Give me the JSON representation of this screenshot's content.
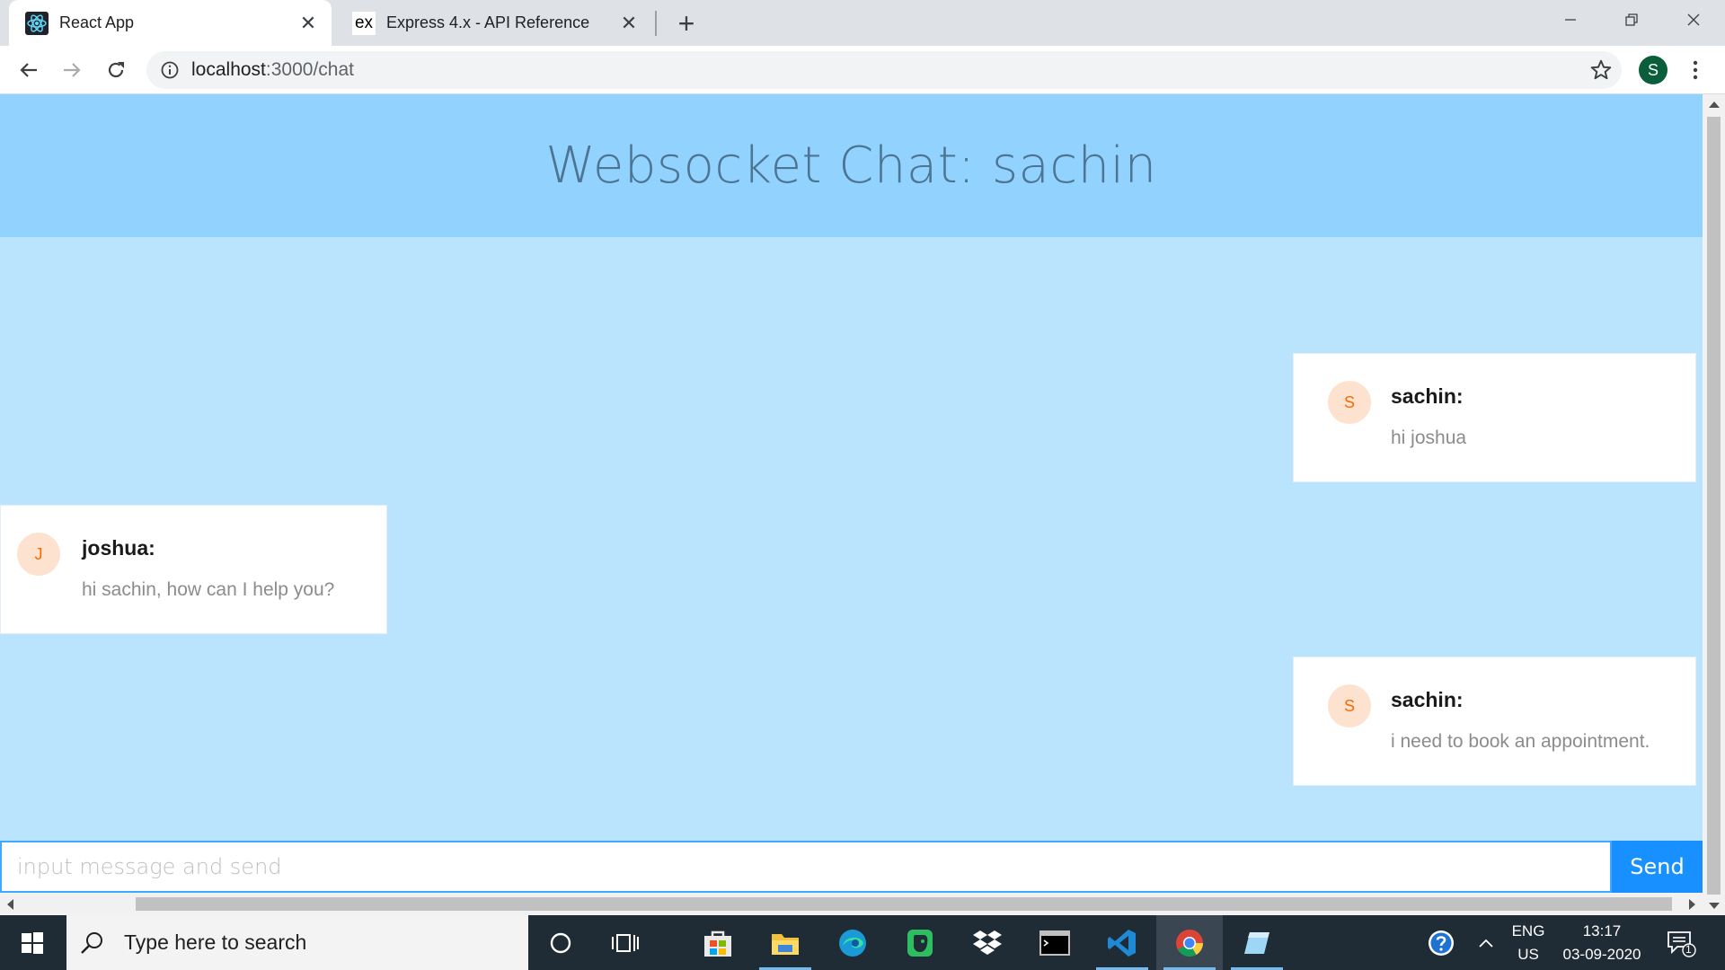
{
  "browser": {
    "tabs": [
      {
        "title": "React App",
        "active": true
      },
      {
        "title": "Express 4.x - API Reference",
        "active": false
      }
    ],
    "express_favicon_text": "ex",
    "url_host": "localhost",
    "url_path": ":3000/chat",
    "profile_initial": "S"
  },
  "chat": {
    "title": "Websocket Chat: sachin",
    "messages": [
      {
        "avatar": "S",
        "author": "sachin:",
        "text": "hi joshua",
        "side": "right"
      },
      {
        "avatar": "J",
        "author": "joshua:",
        "text": "hi sachin, how can I help you?",
        "side": "left"
      },
      {
        "avatar": "S",
        "author": "sachin:",
        "text": "i need to book an appointment.",
        "side": "right"
      }
    ],
    "input_placeholder": "input message and send",
    "input_value": "",
    "send_label": "Send"
  },
  "taskbar": {
    "search_placeholder": "Type here to search",
    "apps": [
      "cortana-icon",
      "task-view-icon",
      "store-icon",
      "file-explorer-icon",
      "edge-icon",
      "evernote-icon",
      "dropbox-icon",
      "terminal-icon",
      "vscode-icon",
      "chrome-icon",
      "notepad-icon"
    ],
    "lang_top": "ENG",
    "lang_bottom": "US",
    "time": "13:17",
    "date": "03-09-2020",
    "notification_count": "1"
  },
  "colors": {
    "header_bg": "#91d3fe",
    "body_bg": "#bae3fd",
    "title_color": "#4d7593",
    "send_button": "#1890ff",
    "avatar_bg": "#fde3cf",
    "avatar_fg": "#f56a00"
  }
}
